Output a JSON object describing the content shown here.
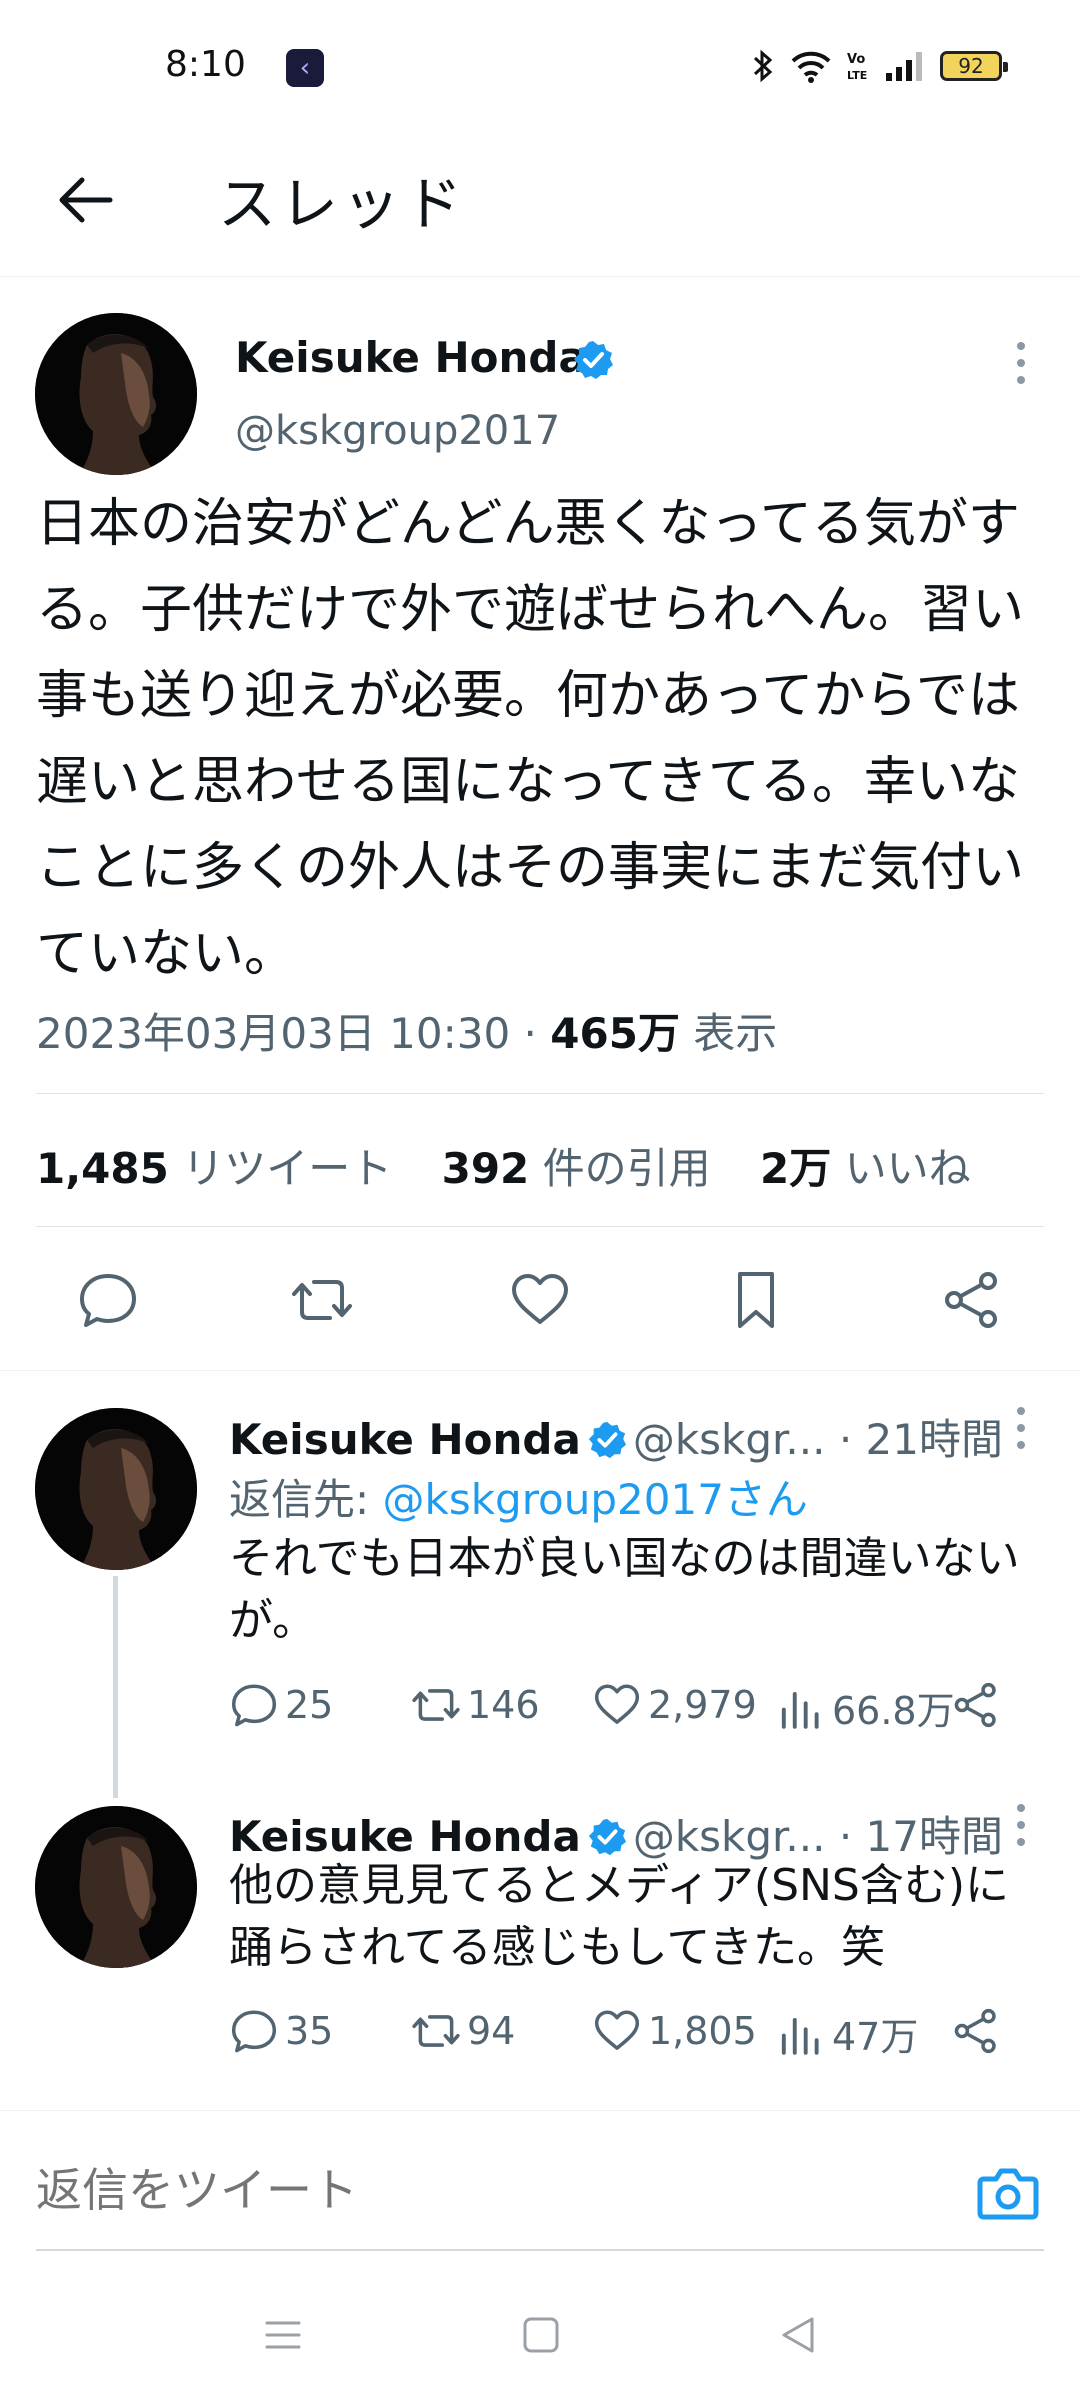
{
  "status_bar": {
    "time": "8:10",
    "battery": "92",
    "icons": [
      "bluetooth-icon",
      "wifi-icon",
      "volte-icon",
      "signal-icon",
      "battery-icon"
    ]
  },
  "header": {
    "title": "スレッド"
  },
  "main_tweet": {
    "name": "Keisuke Honda",
    "handle": "@kskgroup2017",
    "text": "日本の治安がどんどん悪くなってる気がする。子供だけで外で遊ばせられへん。習い事も送り迎えが必要。何かあってからでは遅いと思わせる国になってきてる。幸いなことに多くの外人はその事実にまだ気付いていない。",
    "date": "2023年03月03日 10:30",
    "dot": "·",
    "views": "465万",
    "views_label": "表示",
    "retweets": "1,485",
    "retweets_label": "リツイート",
    "quotes": "392",
    "quotes_label": "件の引用",
    "likes": "2万",
    "likes_label": "いいね"
  },
  "replies": [
    {
      "name": "Keisuke Honda",
      "handle": "@kskgr...",
      "time": "· 21時間",
      "reply_to_label": "返信先: ",
      "reply_to_mention": "@kskgroup2017さん",
      "text": "それでも日本が良い国なのは間違いないが。",
      "comments": "25",
      "retweets": "146",
      "likes": "2,979",
      "views": "66.8万"
    },
    {
      "name": "Keisuke Honda",
      "handle": "@kskgr...",
      "time": "· 17時間",
      "text": "他の意見見てるとメディア(SNS含む)に踊らされてる感じもしてきた。笑",
      "comments": "35",
      "retweets": "94",
      "likes": "1,805",
      "views": "47万"
    }
  ],
  "composer": {
    "placeholder": "返信をツイート"
  },
  "colors": {
    "accent": "#1d9bf0",
    "secondary_text": "#536471",
    "text": "#0f1419"
  }
}
